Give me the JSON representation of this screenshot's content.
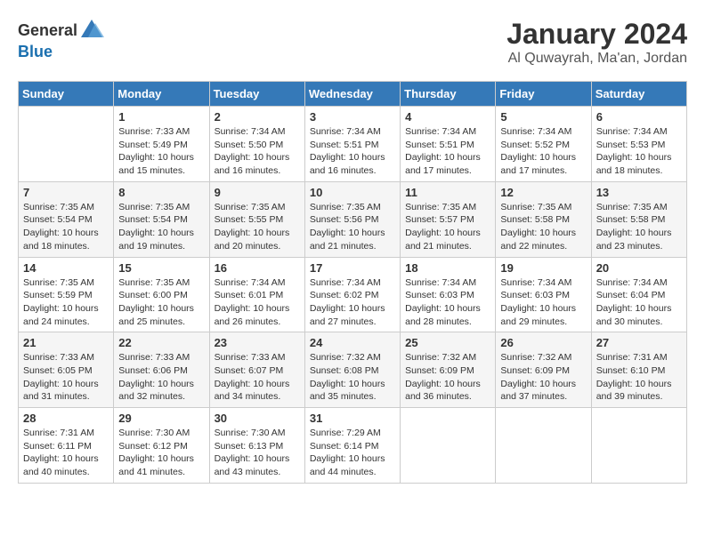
{
  "header": {
    "logo_general": "General",
    "logo_blue": "Blue",
    "month_year": "January 2024",
    "location": "Al Quwayrah, Ma'an, Jordan"
  },
  "weekdays": [
    "Sunday",
    "Monday",
    "Tuesday",
    "Wednesday",
    "Thursday",
    "Friday",
    "Saturday"
  ],
  "weeks": [
    [
      {
        "day": "",
        "sunrise": "",
        "sunset": "",
        "daylight": ""
      },
      {
        "day": "1",
        "sunrise": "Sunrise: 7:33 AM",
        "sunset": "Sunset: 5:49 PM",
        "daylight": "Daylight: 10 hours and 15 minutes."
      },
      {
        "day": "2",
        "sunrise": "Sunrise: 7:34 AM",
        "sunset": "Sunset: 5:50 PM",
        "daylight": "Daylight: 10 hours and 16 minutes."
      },
      {
        "day": "3",
        "sunrise": "Sunrise: 7:34 AM",
        "sunset": "Sunset: 5:51 PM",
        "daylight": "Daylight: 10 hours and 16 minutes."
      },
      {
        "day": "4",
        "sunrise": "Sunrise: 7:34 AM",
        "sunset": "Sunset: 5:51 PM",
        "daylight": "Daylight: 10 hours and 17 minutes."
      },
      {
        "day": "5",
        "sunrise": "Sunrise: 7:34 AM",
        "sunset": "Sunset: 5:52 PM",
        "daylight": "Daylight: 10 hours and 17 minutes."
      },
      {
        "day": "6",
        "sunrise": "Sunrise: 7:34 AM",
        "sunset": "Sunset: 5:53 PM",
        "daylight": "Daylight: 10 hours and 18 minutes."
      }
    ],
    [
      {
        "day": "7",
        "sunrise": "Sunrise: 7:35 AM",
        "sunset": "Sunset: 5:54 PM",
        "daylight": "Daylight: 10 hours and 18 minutes."
      },
      {
        "day": "8",
        "sunrise": "Sunrise: 7:35 AM",
        "sunset": "Sunset: 5:54 PM",
        "daylight": "Daylight: 10 hours and 19 minutes."
      },
      {
        "day": "9",
        "sunrise": "Sunrise: 7:35 AM",
        "sunset": "Sunset: 5:55 PM",
        "daylight": "Daylight: 10 hours and 20 minutes."
      },
      {
        "day": "10",
        "sunrise": "Sunrise: 7:35 AM",
        "sunset": "Sunset: 5:56 PM",
        "daylight": "Daylight: 10 hours and 21 minutes."
      },
      {
        "day": "11",
        "sunrise": "Sunrise: 7:35 AM",
        "sunset": "Sunset: 5:57 PM",
        "daylight": "Daylight: 10 hours and 21 minutes."
      },
      {
        "day": "12",
        "sunrise": "Sunrise: 7:35 AM",
        "sunset": "Sunset: 5:58 PM",
        "daylight": "Daylight: 10 hours and 22 minutes."
      },
      {
        "day": "13",
        "sunrise": "Sunrise: 7:35 AM",
        "sunset": "Sunset: 5:58 PM",
        "daylight": "Daylight: 10 hours and 23 minutes."
      }
    ],
    [
      {
        "day": "14",
        "sunrise": "Sunrise: 7:35 AM",
        "sunset": "Sunset: 5:59 PM",
        "daylight": "Daylight: 10 hours and 24 minutes."
      },
      {
        "day": "15",
        "sunrise": "Sunrise: 7:35 AM",
        "sunset": "Sunset: 6:00 PM",
        "daylight": "Daylight: 10 hours and 25 minutes."
      },
      {
        "day": "16",
        "sunrise": "Sunrise: 7:34 AM",
        "sunset": "Sunset: 6:01 PM",
        "daylight": "Daylight: 10 hours and 26 minutes."
      },
      {
        "day": "17",
        "sunrise": "Sunrise: 7:34 AM",
        "sunset": "Sunset: 6:02 PM",
        "daylight": "Daylight: 10 hours and 27 minutes."
      },
      {
        "day": "18",
        "sunrise": "Sunrise: 7:34 AM",
        "sunset": "Sunset: 6:03 PM",
        "daylight": "Daylight: 10 hours and 28 minutes."
      },
      {
        "day": "19",
        "sunrise": "Sunrise: 7:34 AM",
        "sunset": "Sunset: 6:03 PM",
        "daylight": "Daylight: 10 hours and 29 minutes."
      },
      {
        "day": "20",
        "sunrise": "Sunrise: 7:34 AM",
        "sunset": "Sunset: 6:04 PM",
        "daylight": "Daylight: 10 hours and 30 minutes."
      }
    ],
    [
      {
        "day": "21",
        "sunrise": "Sunrise: 7:33 AM",
        "sunset": "Sunset: 6:05 PM",
        "daylight": "Daylight: 10 hours and 31 minutes."
      },
      {
        "day": "22",
        "sunrise": "Sunrise: 7:33 AM",
        "sunset": "Sunset: 6:06 PM",
        "daylight": "Daylight: 10 hours and 32 minutes."
      },
      {
        "day": "23",
        "sunrise": "Sunrise: 7:33 AM",
        "sunset": "Sunset: 6:07 PM",
        "daylight": "Daylight: 10 hours and 34 minutes."
      },
      {
        "day": "24",
        "sunrise": "Sunrise: 7:32 AM",
        "sunset": "Sunset: 6:08 PM",
        "daylight": "Daylight: 10 hours and 35 minutes."
      },
      {
        "day": "25",
        "sunrise": "Sunrise: 7:32 AM",
        "sunset": "Sunset: 6:09 PM",
        "daylight": "Daylight: 10 hours and 36 minutes."
      },
      {
        "day": "26",
        "sunrise": "Sunrise: 7:32 AM",
        "sunset": "Sunset: 6:09 PM",
        "daylight": "Daylight: 10 hours and 37 minutes."
      },
      {
        "day": "27",
        "sunrise": "Sunrise: 7:31 AM",
        "sunset": "Sunset: 6:10 PM",
        "daylight": "Daylight: 10 hours and 39 minutes."
      }
    ],
    [
      {
        "day": "28",
        "sunrise": "Sunrise: 7:31 AM",
        "sunset": "Sunset: 6:11 PM",
        "daylight": "Daylight: 10 hours and 40 minutes."
      },
      {
        "day": "29",
        "sunrise": "Sunrise: 7:30 AM",
        "sunset": "Sunset: 6:12 PM",
        "daylight": "Daylight: 10 hours and 41 minutes."
      },
      {
        "day": "30",
        "sunrise": "Sunrise: 7:30 AM",
        "sunset": "Sunset: 6:13 PM",
        "daylight": "Daylight: 10 hours and 43 minutes."
      },
      {
        "day": "31",
        "sunrise": "Sunrise: 7:29 AM",
        "sunset": "Sunset: 6:14 PM",
        "daylight": "Daylight: 10 hours and 44 minutes."
      },
      {
        "day": "",
        "sunrise": "",
        "sunset": "",
        "daylight": ""
      },
      {
        "day": "",
        "sunrise": "",
        "sunset": "",
        "daylight": ""
      },
      {
        "day": "",
        "sunrise": "",
        "sunset": "",
        "daylight": ""
      }
    ]
  ]
}
